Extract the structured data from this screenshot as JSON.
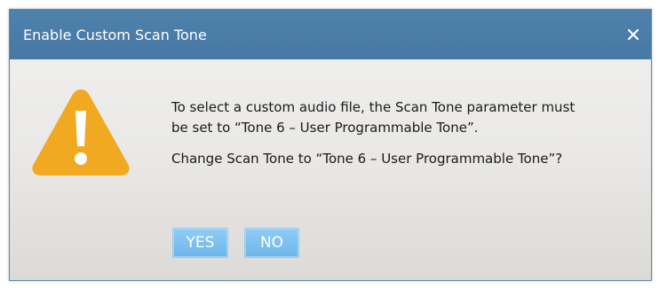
{
  "dialog": {
    "title": "Enable Custom Scan Tone",
    "close_symbol": "×",
    "icon": "warning-icon",
    "message_line1": "To select a custom audio file, the Scan Tone parameter must",
    "message_line2": "be set to “Tone 6 – User Programmable Tone”.",
    "question": "Change Scan Tone to “Tone 6 – User Programmable Tone”?",
    "buttons": {
      "yes": "YES",
      "no": "NO"
    }
  },
  "colors": {
    "titlebar": "#4f81ad",
    "title_text": "#ffffff",
    "warning": "#f0a920",
    "button": "#7cc0f0"
  }
}
